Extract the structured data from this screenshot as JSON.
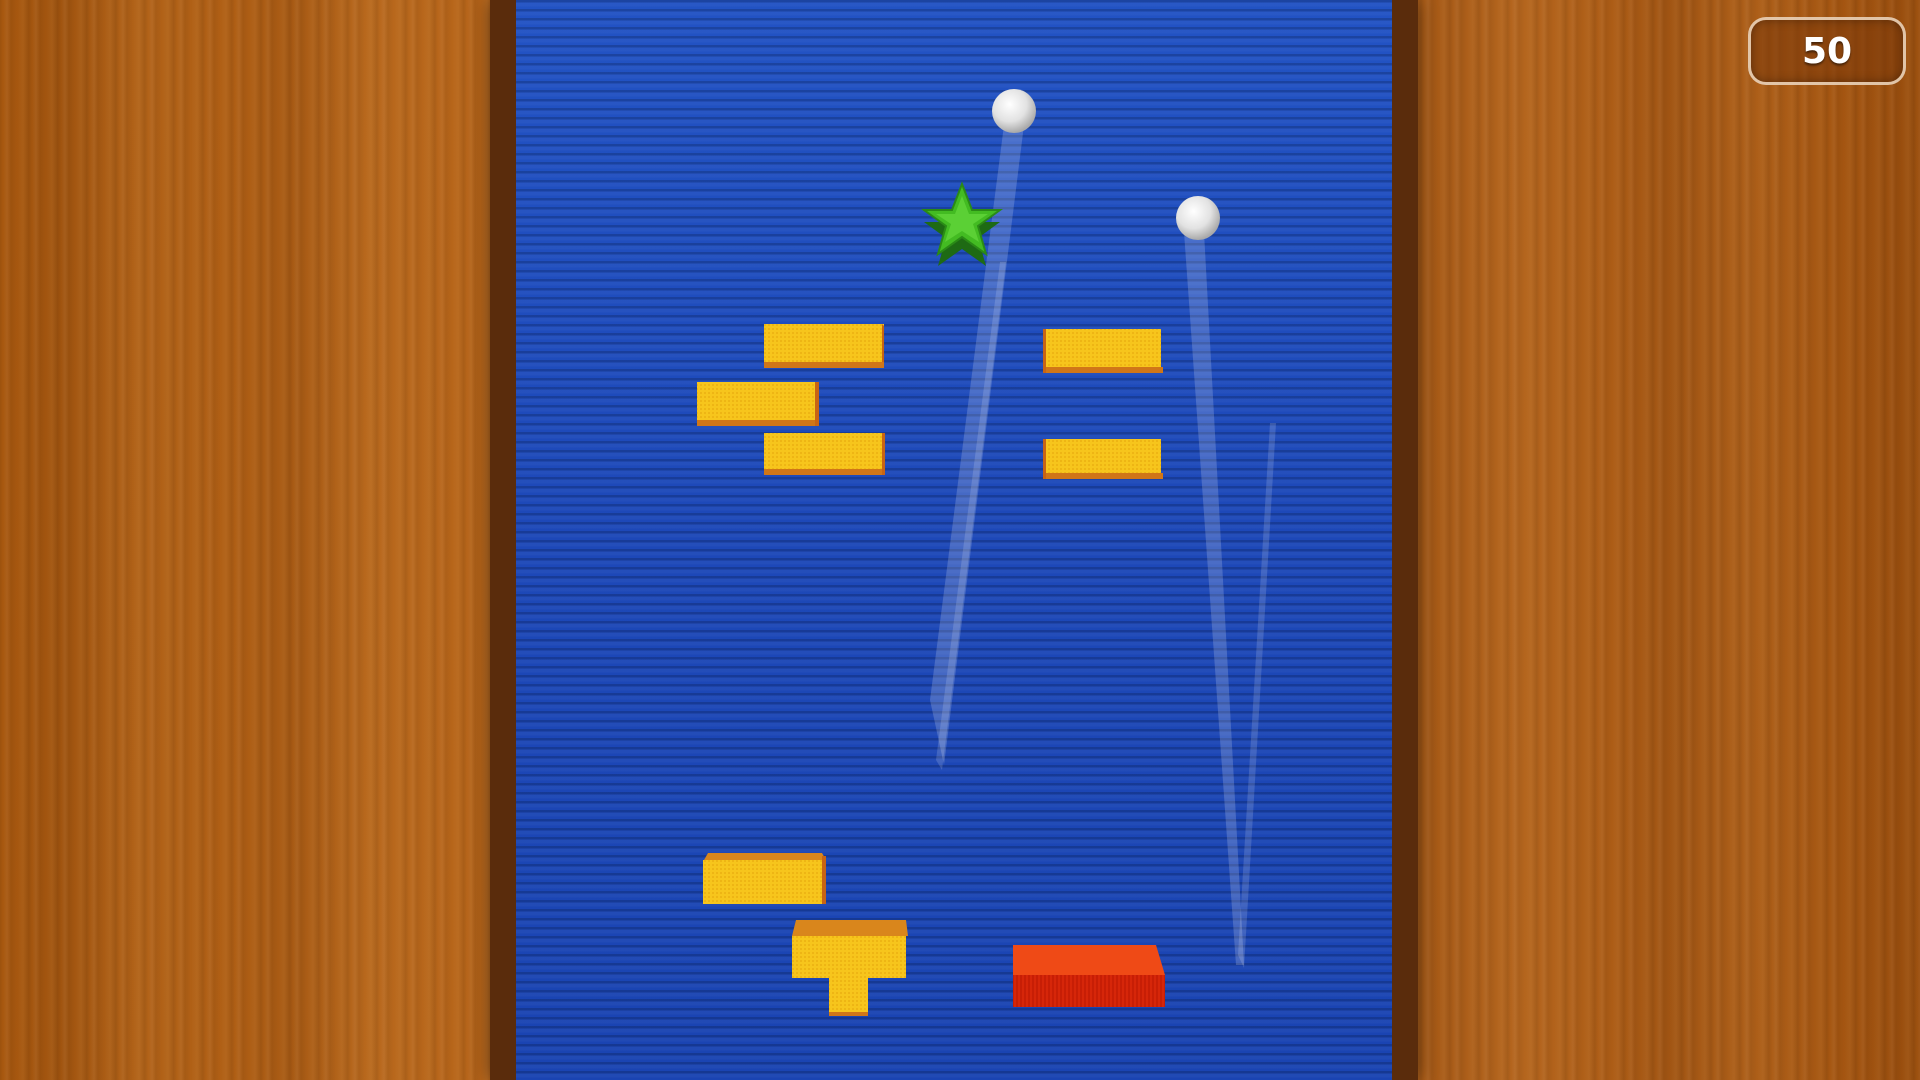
{
  "hud": {
    "score": "50"
  },
  "colors": {
    "board_blue": "#1d48b8",
    "frame_brown": "#5a2c0c",
    "wood": "#b0601a",
    "brick_yellow": "#f5c21a",
    "brick_orange_side": "#d8781a",
    "block_red": "#e8340c",
    "star_green": "#3bb020",
    "ball_white": "#f2f2f2"
  },
  "pieces": {
    "ball_count": 2,
    "star_icon": "green-star",
    "yellow_brick_count": 7,
    "t_block_count": 1,
    "red_block_count": 1
  }
}
